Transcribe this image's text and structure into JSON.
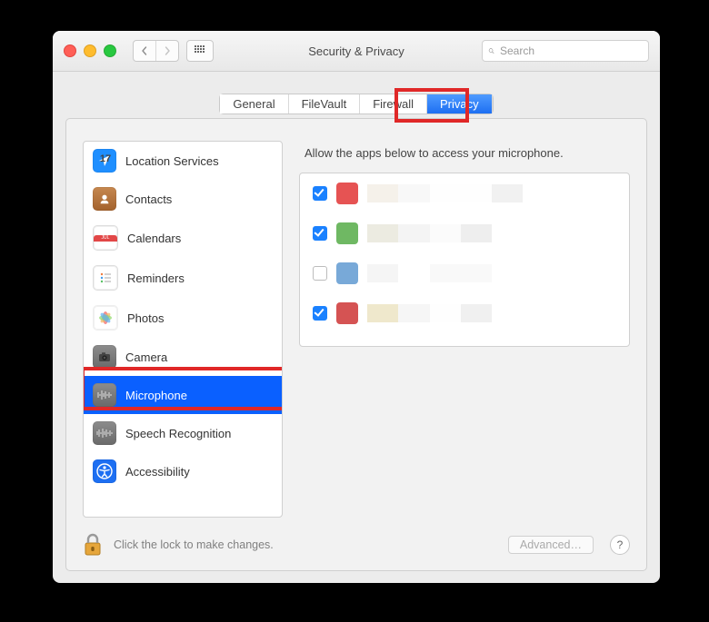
{
  "window": {
    "title": "Security & Privacy",
    "search_placeholder": "Search"
  },
  "tabs": [
    {
      "label": "General",
      "active": false
    },
    {
      "label": "FileVault",
      "active": false
    },
    {
      "label": "Firewall",
      "active": false
    },
    {
      "label": "Privacy",
      "active": true
    }
  ],
  "sidebar": {
    "items": [
      {
        "label": "Location Services",
        "icon": "location-icon",
        "selected": false
      },
      {
        "label": "Contacts",
        "icon": "contacts-icon",
        "selected": false
      },
      {
        "label": "Calendars",
        "icon": "calendar-icon",
        "selected": false
      },
      {
        "label": "Reminders",
        "icon": "reminders-icon",
        "selected": false
      },
      {
        "label": "Photos",
        "icon": "photos-icon",
        "selected": false
      },
      {
        "label": "Camera",
        "icon": "camera-icon",
        "selected": false
      },
      {
        "label": "Microphone",
        "icon": "microphone-icon",
        "selected": true
      },
      {
        "label": "Speech Recognition",
        "icon": "speech-icon",
        "selected": false
      },
      {
        "label": "Accessibility",
        "icon": "accessibility-icon",
        "selected": false
      }
    ]
  },
  "right_panel": {
    "heading": "Allow the apps below to access your microphone.",
    "apps": [
      {
        "checked": true,
        "icon_color": "#e34747"
      },
      {
        "checked": true,
        "icon_color": "#63b25b"
      },
      {
        "checked": false,
        "icon_color": "#77a8d6"
      },
      {
        "checked": true,
        "icon_color": "#d35050"
      }
    ]
  },
  "footer": {
    "lock_text": "Click the lock to make changes.",
    "advanced_label": "Advanced…",
    "help_label": "?"
  },
  "annotations": {
    "tab_highlight": "Privacy",
    "sidebar_highlight": "Microphone"
  }
}
